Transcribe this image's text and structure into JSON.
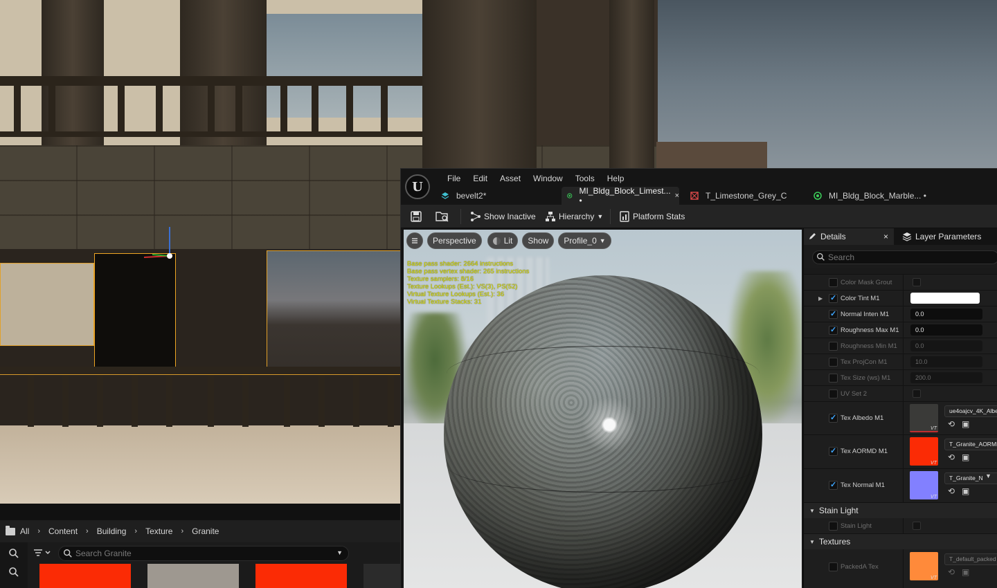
{
  "content_browser": {
    "breadcrumbs": [
      "All",
      "Content",
      "Building",
      "Texture",
      "Granite"
    ],
    "search_placeholder": "Search Granite",
    "asset_colors": [
      "#fb2b05",
      "#9e9890",
      "#fb2b05",
      "#2b2b2b"
    ]
  },
  "editor": {
    "menu": [
      "File",
      "Edit",
      "Asset",
      "Window",
      "Tools",
      "Help"
    ],
    "tabs": [
      {
        "label": "bevelt2*",
        "icon": "map-icon",
        "active": false
      },
      {
        "label": "MI_Bldg_Block_Limest... •",
        "icon": "material-instance-icon",
        "active": true,
        "close": "×"
      },
      {
        "label": "T_Limestone_Grey_C",
        "icon": "texture-icon",
        "active": false
      },
      {
        "label": "MI_Bldg_Block_Marble... •",
        "icon": "material-instance-icon",
        "active": false
      }
    ],
    "toolbar": {
      "show_inactive": "Show Inactive",
      "hierarchy": "Hierarchy",
      "platform_stats": "Platform Stats"
    },
    "viewport": {
      "perspective": "Perspective",
      "lit": "Lit",
      "show": "Show",
      "profile": "Profile_0",
      "stats": [
        "Base pass shader: 2664 instructions",
        "Base pass vertex shader: 265 instructions",
        "Texture samplers: 8/16",
        "Texture Lookups (Est.): VS(3), PS(52)",
        "Virtual Texture Lookups (Est.): 36",
        "Virtual Texture Stacks: 31"
      ]
    },
    "details": {
      "tab_details": "Details",
      "tab_close": "×",
      "tab_layer": "Layer Parameters",
      "search_placeholder": "Search",
      "rows": [
        {
          "label": "Color Mask Grout",
          "checked": false,
          "kind": "bool"
        },
        {
          "label": "Color Tint M1",
          "checked": true,
          "kind": "color"
        },
        {
          "label": "Normal Inten M1",
          "checked": true,
          "kind": "number",
          "value": "0.0"
        },
        {
          "label": "Roughness Max M1",
          "checked": true,
          "kind": "number",
          "value": "0.0"
        },
        {
          "label": "Roughness Min M1",
          "checked": false,
          "kind": "number",
          "value": "0.0"
        },
        {
          "label": "Tex ProjCon M1",
          "checked": false,
          "kind": "number",
          "value": "10.0"
        },
        {
          "label": "Tex Size (ws) M1",
          "checked": false,
          "kind": "number",
          "value": "200.0"
        },
        {
          "label": "UV Set 2",
          "checked": false,
          "kind": "bool"
        }
      ],
      "texture_rows": [
        {
          "label": "Tex Albedo M1",
          "checked": true,
          "asset": "ue4oajcv_4K_Albe",
          "thumb_color": "#3a3a38"
        },
        {
          "label": "Tex AORMD M1",
          "checked": true,
          "asset": "T_Granite_AORMI",
          "thumb_color": "#fb2b05"
        },
        {
          "label": "Tex Normal M1",
          "checked": true,
          "asset": "T_Granite_N",
          "thumb_color": "#8280ff"
        }
      ],
      "vt_badge": "VT",
      "section_stain": "Stain Light",
      "stain_row": "Stain Light",
      "section_textures": "Textures",
      "packed_row": {
        "label": "PackedA Tex",
        "asset": "T_default_packed",
        "thumb_color": "#ff8a3a"
      }
    }
  }
}
